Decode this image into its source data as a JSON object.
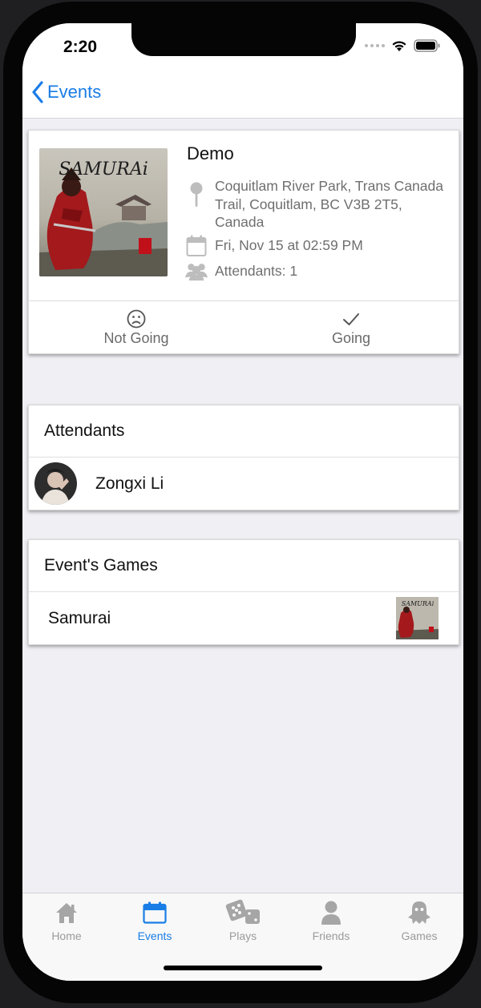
{
  "status_bar": {
    "time": "2:20"
  },
  "nav": {
    "back_label": "Events"
  },
  "event": {
    "title": "Demo",
    "cover_title": "SAMURAi",
    "location": "Coquitlam River Park, Trans Canada Trail, Coquitlam, BC V3B 2T5, Canada",
    "datetime": "Fri, Nov 15 at 02:59 PM",
    "attendants": "Attendants: 1",
    "actions": {
      "not_going": "Not Going",
      "going": "Going"
    }
  },
  "attendants_section": {
    "header": "Attendants",
    "items": [
      {
        "name": "Zongxi Li"
      }
    ]
  },
  "games_section": {
    "header": "Event's Games",
    "items": [
      {
        "name": "Samurai",
        "thumb_title": "SAMURAi"
      }
    ]
  },
  "tabs": [
    {
      "label": "Home",
      "icon": "home-icon"
    },
    {
      "label": "Events",
      "icon": "calendar-icon",
      "active": true
    },
    {
      "label": "Plays",
      "icon": "dice-icon"
    },
    {
      "label": "Friends",
      "icon": "person-icon"
    },
    {
      "label": "Games",
      "icon": "ghost-icon"
    }
  ],
  "colors": {
    "accent": "#1a7de6",
    "inactive_tab": "#9a9a9a",
    "background": "#efeff4"
  }
}
